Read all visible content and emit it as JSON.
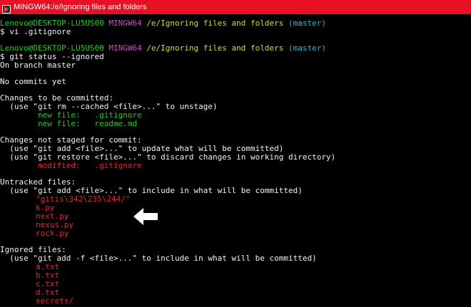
{
  "window": {
    "title": "MINGW64:/e/Ignoring files and folders",
    "icon": "git-bash-icon",
    "colors": {
      "titlebar": "#e81123"
    }
  },
  "terminal": {
    "colors": {
      "background": "#000000",
      "user": "#1bd01b",
      "shell": "#c154c1",
      "path": "#d8d83a",
      "branch": "#2fb5d6",
      "staged": "#1bd01b",
      "unstaged": "#e3262d"
    },
    "prompt1": {
      "user_host": "Lenovo@DESKTOP-LU5US00",
      "shell": "MINGW64",
      "path": "/e/Ignoring files and folders",
      "branch": "(master)",
      "command": "$ vi .gitignore"
    },
    "prompt2": {
      "user_host": "Lenovo@DESKTOP-LU5US00",
      "shell": "MINGW64",
      "path": "/e/Ignoring files and folders",
      "branch": "(master)",
      "command": "$ git status --ignored"
    },
    "status": {
      "on_branch": "On branch master",
      "no_commits": "No commits yet",
      "to_be_committed": {
        "header": "Changes to be committed:",
        "hint": "  (use \"git rm --cached <file>...\" to unstage)",
        "files": [
          {
            "status": "new file:",
            "name": ".gitignore"
          },
          {
            "status": "new file:",
            "name": "readme.md"
          }
        ]
      },
      "not_staged": {
        "header": "Changes not staged for commit:",
        "hints": [
          "  (use \"git add <file>...\" to update what will be committed)",
          "  (use \"git restore <file>...\" to discard changes in working directory)"
        ],
        "files": [
          {
            "status": "modified:",
            "name": ".gitignore"
          }
        ]
      },
      "untracked": {
        "header": "Untracked files:",
        "hint": "  (use \"git add <file>...\" to include in what will be committed)",
        "files": [
          "\"gitis\\342\\235\\244/\"",
          "k.py",
          "next.py",
          "nexus.py",
          "rock.py"
        ]
      },
      "ignored": {
        "header": "Ignored files:",
        "hint": "  (use \"git add -f <file>...\" to include in what will be committed)",
        "files": [
          "a.txt",
          "b.txt",
          "c.txt",
          "d.txt",
          "secrets/"
        ]
      }
    },
    "annotation": {
      "icon": "left-arrow-icon",
      "color": "#ffffff"
    }
  }
}
